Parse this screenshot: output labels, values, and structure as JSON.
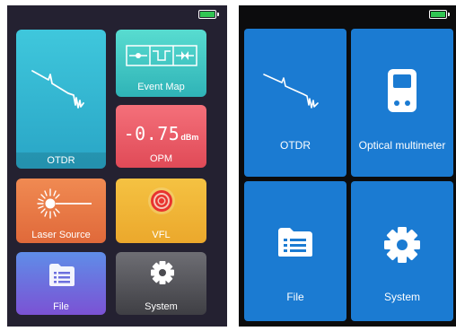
{
  "left_screen": {
    "battery_color": "#31c553",
    "tiles": [
      {
        "label": "OTDR",
        "icon": "otdr-trace-icon",
        "color": "#35b6d1"
      },
      {
        "label": "Event Map",
        "icon": "event-map-icon",
        "color": "#45c8c4"
      },
      {
        "label": "OPM",
        "icon": "power-meter-readout",
        "color": "#ea5d68",
        "readout_value": "-0.75",
        "readout_unit": "dBm"
      },
      {
        "label": "Laser Source",
        "icon": "laser-burst-icon",
        "color": "#e87946"
      },
      {
        "label": "VFL",
        "icon": "target-icon",
        "color": "#f0b536"
      },
      {
        "label": "File",
        "icon": "file-folder-icon",
        "color": "#6c70de"
      },
      {
        "label": "System",
        "icon": "gear-icon",
        "color": "#56565c"
      }
    ]
  },
  "right_screen": {
    "battery_color": "#31c553",
    "tile_color": "#1b7bd2",
    "tiles": [
      {
        "label": "OTDR",
        "icon": "otdr-trace-icon"
      },
      {
        "label": "Optical multimeter",
        "icon": "multimeter-device-icon"
      },
      {
        "label": "File",
        "icon": "file-folder-icon"
      },
      {
        "label": "System",
        "icon": "gear-icon"
      }
    ]
  }
}
